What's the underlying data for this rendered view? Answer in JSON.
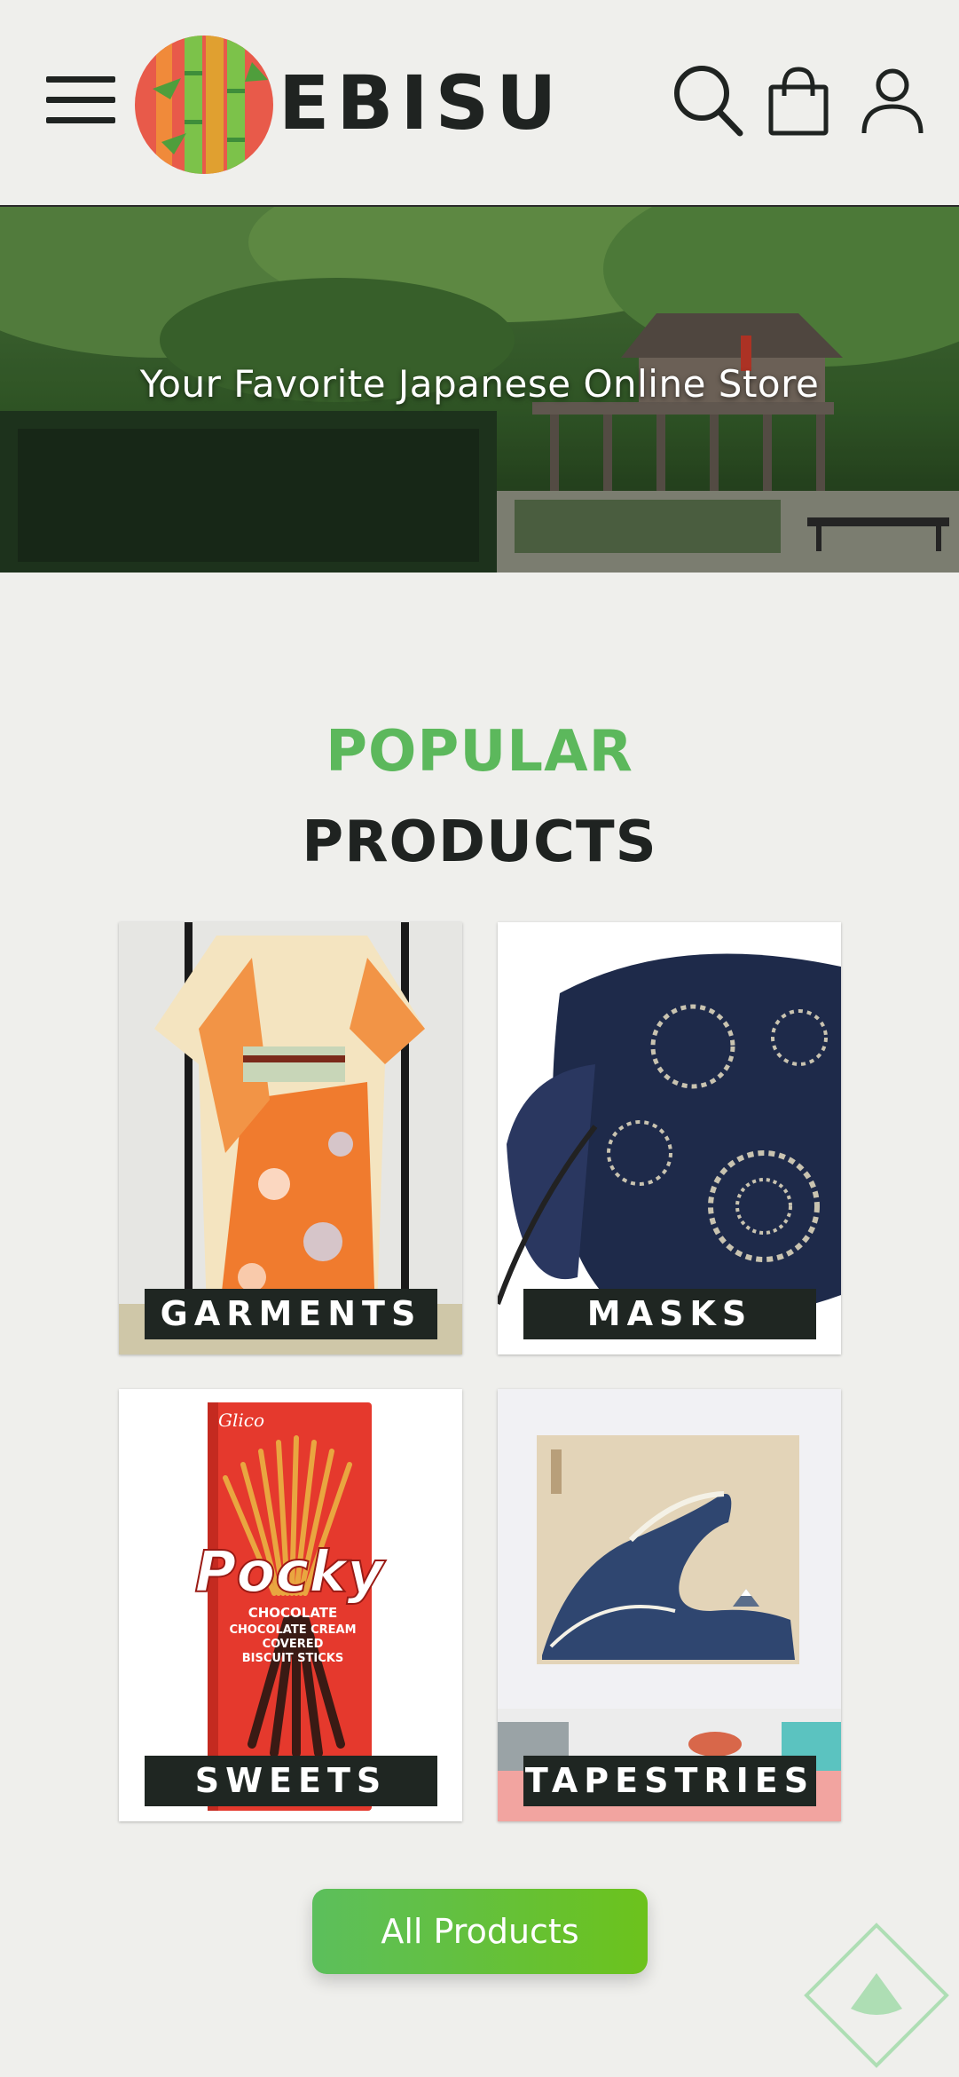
{
  "header": {
    "brand": "EBISU",
    "icons": [
      "menu-icon",
      "bamboo-logo",
      "search-icon",
      "shopping-bag-icon",
      "user-icon"
    ]
  },
  "hero": {
    "title": "Your Favorite Japanese Online Store"
  },
  "section": {
    "title_line1": "POPULAR",
    "title_line2": "PRODUCTS"
  },
  "products": [
    {
      "label": "GARMENTS"
    },
    {
      "label": "MASKS"
    },
    {
      "label": "SWEETS"
    },
    {
      "label": "TAPESTRIES"
    }
  ],
  "pocky_box": {
    "brand_small": "Glico",
    "brand": "Pocky",
    "line1": "CHOCOLATE",
    "line2": "CHOCOLATE CREAM",
    "line3": "COVERED",
    "line4": "BISCUIT STICKS"
  },
  "cta": {
    "label": "All Products"
  },
  "colors": {
    "accent_green": "#5cb85c",
    "dark": "#1f2321",
    "background": "#efefec",
    "label_bg": "#1f2622"
  }
}
